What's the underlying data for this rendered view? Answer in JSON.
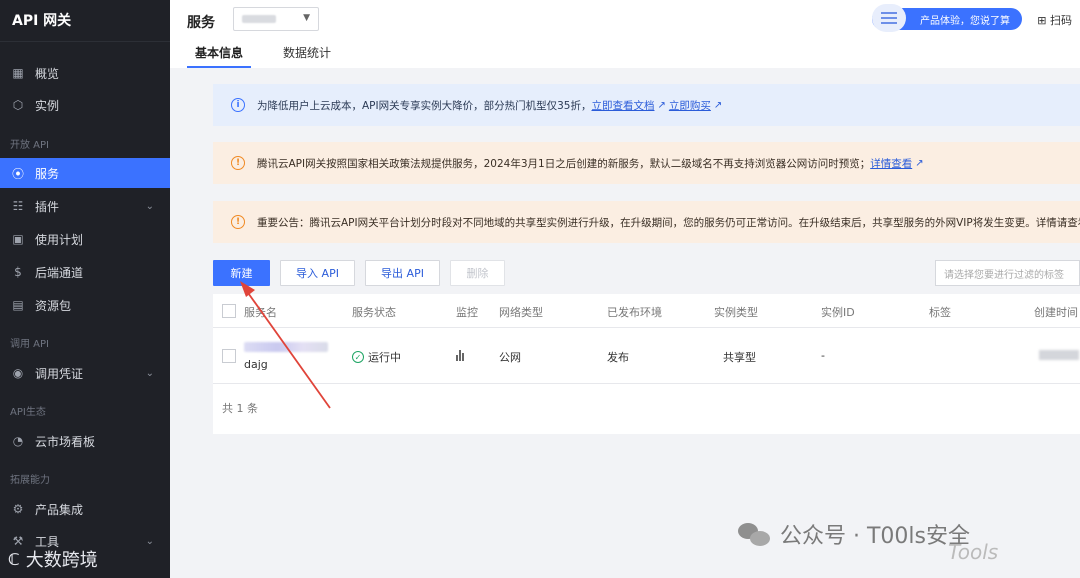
{
  "sidebar": {
    "brand": "API 网关",
    "items": [
      {
        "label": "概览"
      },
      {
        "label": "实例"
      },
      {
        "label": "服务"
      },
      {
        "label": "插件"
      },
      {
        "label": "使用计划"
      },
      {
        "label": "后端通道"
      },
      {
        "label": "资源包"
      },
      {
        "label": "调用凭证"
      },
      {
        "label": "云市场看板"
      },
      {
        "label": "产品集成"
      },
      {
        "label": "工具"
      }
    ],
    "sections": [
      "开放 API",
      "调用 API",
      "API生态",
      "拓展能力"
    ],
    "bottom_logo": "大数跨境"
  },
  "header": {
    "title": "服务",
    "tabs": [
      "基本信息",
      "数据统计"
    ],
    "promo": "产品体验，您说了算",
    "scan": "扫码"
  },
  "banners": {
    "info": {
      "text": "为降低用户上云成本，API网关专享实例大降价，部分热门机型仅35折，",
      "link1": "立即查看文档",
      "link2": "立即购买"
    },
    "warn1": {
      "text": "腾讯云API网关按照国家相关政策法规提供服务，2024年3月1日之后创建的新服务，默认二级域名不再支持浏览器公网访问时预览；",
      "link": "详情查看"
    },
    "warn2": {
      "text": "重要公告：腾讯云API网关平台计划分时段对不同地域的共享型实例进行升级，在升级期间，您的服务仍可正常访问。在升级结束后，共享型服务的外网VIP将发生变更。详情请查看"
    }
  },
  "toolbar": {
    "new": "新建",
    "import": "导入 API",
    "export": "导出 API",
    "delete": "删除",
    "filter_placeholder": "请选择您要进行过滤的标签"
  },
  "table": {
    "columns": [
      "服务名",
      "服务状态",
      "监控",
      "网络类型",
      "已发布环境",
      "实例类型",
      "实例ID",
      "标签",
      "创建时间"
    ],
    "rows": [
      {
        "name": "dajg",
        "status": "运行中",
        "network": "公网",
        "env": "发布",
        "instance_type": "共享型",
        "instance_id": "-"
      }
    ],
    "footer": "共 1 条"
  },
  "watermark": {
    "text": "公众号 · T00ls安全",
    "logo": "Tools"
  },
  "colors": {
    "accent": "#3b72ff",
    "sidebar_bg": "#1f2127",
    "info_bg": "#e6eefc",
    "warn_bg": "#fbeee2",
    "success": "#1fa564",
    "annotation": "#e0443a"
  }
}
